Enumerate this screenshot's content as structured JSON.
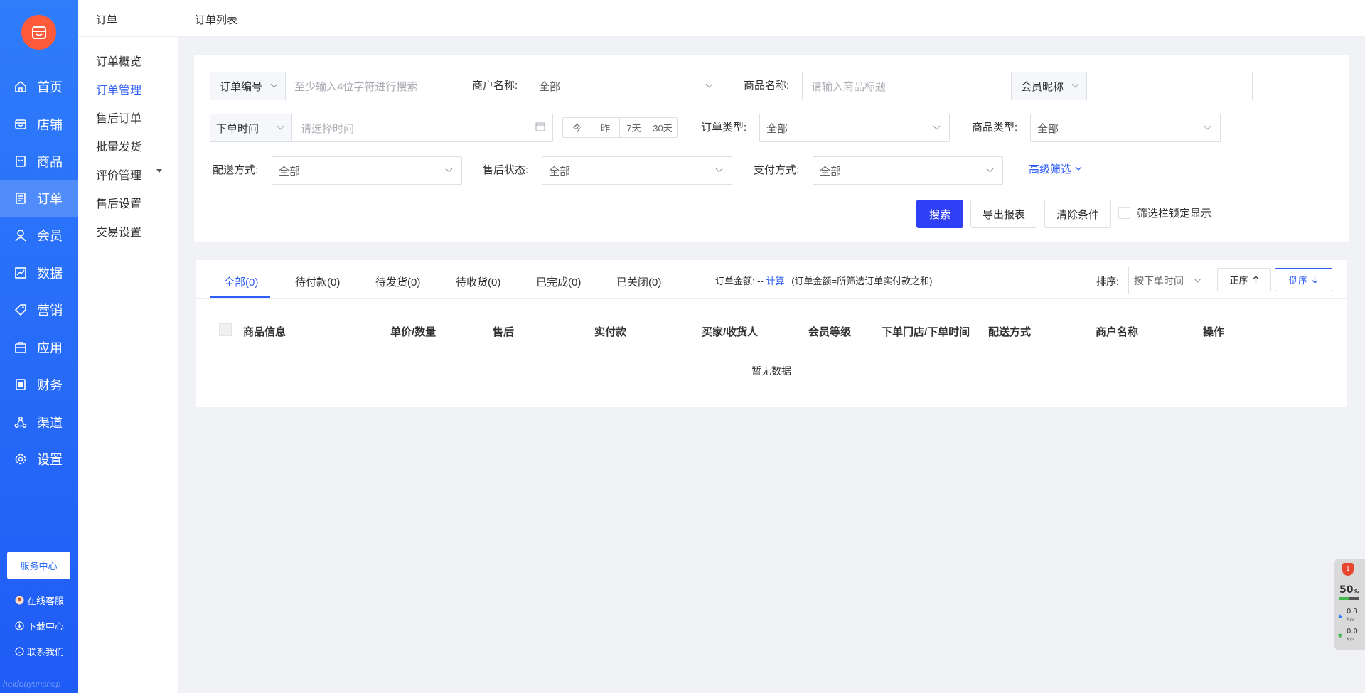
{
  "main_nav": {
    "items": [
      {
        "label": "首页",
        "icon": "home-icon"
      },
      {
        "label": "店铺",
        "icon": "store-icon"
      },
      {
        "label": "商品",
        "icon": "product-icon"
      },
      {
        "label": "订单",
        "icon": "order-icon",
        "active": true
      },
      {
        "label": "会员",
        "icon": "user-icon"
      },
      {
        "label": "数据",
        "icon": "chart-icon"
      },
      {
        "label": "营销",
        "icon": "tag-icon"
      },
      {
        "label": "应用",
        "icon": "app-icon"
      },
      {
        "label": "财务",
        "icon": "finance-icon"
      },
      {
        "label": "渠道",
        "icon": "channel-icon"
      },
      {
        "label": "设置",
        "icon": "gear-icon"
      }
    ],
    "service_center": "服务中心",
    "links": {
      "online_service": "在线客服",
      "download_center": "下载中心",
      "contact_us": "联系我们"
    },
    "watermark": "heidouyunshop"
  },
  "sub_nav": {
    "title": "订单",
    "items": [
      "订单概览",
      "订单管理",
      "售后订单",
      "批量发货",
      "评价管理",
      "售后设置",
      "交易设置"
    ],
    "active_index": 1
  },
  "header": {
    "title": "订单列表"
  },
  "filters": {
    "order_no_select": "订单编号",
    "order_no_placeholder": "至少输入4位字符进行搜索",
    "merchant_label": "商户名称:",
    "merchant_value": "全部",
    "product_name_label": "商品名称:",
    "product_name_placeholder": "请输入商品标题",
    "member_select": "会员昵称",
    "time_select": "下单时间",
    "time_placeholder": "请选择时间",
    "quick_dates": [
      "今",
      "昨",
      "7天",
      "30天"
    ],
    "order_type_label": "订单类型:",
    "order_type_value": "全部",
    "product_type_label": "商品类型:",
    "product_type_value": "全部",
    "delivery_label": "配送方式:",
    "delivery_value": "全部",
    "aftersale_label": "售后状态:",
    "aftersale_value": "全部",
    "payment_label": "支付方式:",
    "payment_value": "全部",
    "advanced": "高级筛选",
    "search_btn": "搜索",
    "export_btn": "导出报表",
    "clear_btn": "清除条件",
    "lock_label": "筛选栏锁定显示"
  },
  "list": {
    "tabs": [
      "全部(0)",
      "待付款(0)",
      "待发货(0)",
      "待收货(0)",
      "已完成(0)",
      "已关闭(0)"
    ],
    "active_tab": 0,
    "amount_label": "订单金额:",
    "amount_value": "--",
    "amount_link": "计算",
    "amount_note": "(订单金额=所筛选订单实付款之和)",
    "sort_label": "排序:",
    "sort_value": "按下单时间",
    "asc": "正序",
    "desc": "倒序",
    "columns": [
      "商品信息",
      "单价/数量",
      "售后",
      "实付款",
      "买家/收货人",
      "会员等级",
      "下单门店/下单时间",
      "配送方式",
      "商户名称",
      "操作"
    ],
    "empty": "暂无数据"
  },
  "widget": {
    "badge": "1",
    "percent": "50",
    "percent_unit": "%",
    "cpu_level": 0.5,
    "up_speed": "0.3",
    "down_speed": "0.0",
    "speed_unit": "K/s"
  }
}
